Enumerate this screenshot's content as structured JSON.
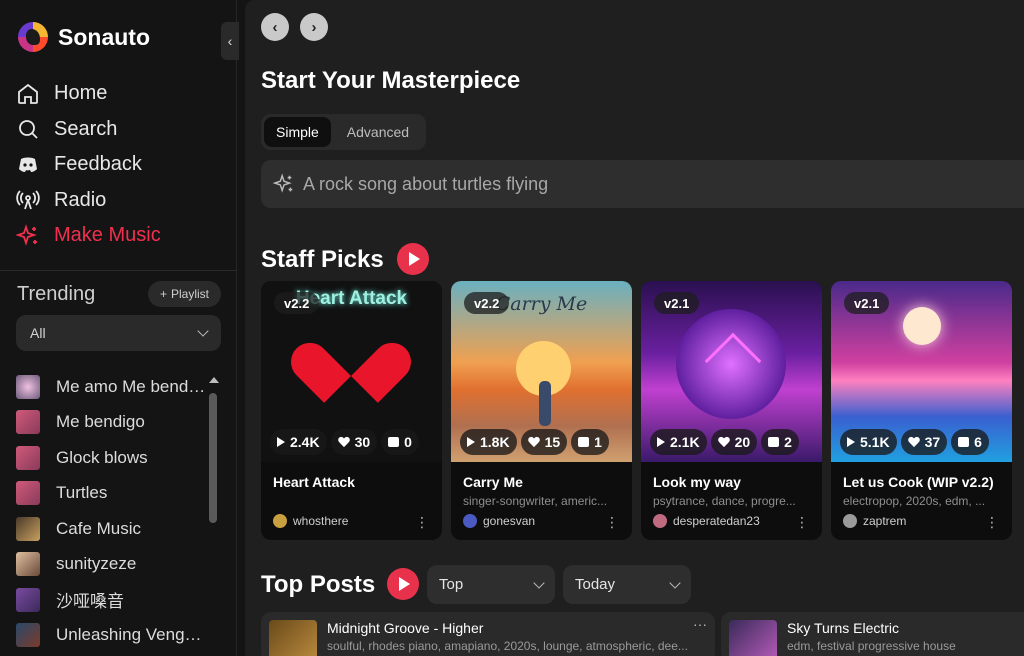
{
  "sidebar": {
    "brand": "Sonauto",
    "nav": [
      {
        "label": "Home",
        "icon": "home-icon"
      },
      {
        "label": "Search",
        "icon": "search-icon"
      },
      {
        "label": "Feedback",
        "icon": "discord-icon"
      },
      {
        "label": "Radio",
        "icon": "radio-icon"
      },
      {
        "label": "Make Music",
        "icon": "sparkle-icon",
        "active": true
      }
    ],
    "trending_title": "Trending",
    "playlist_button": "Playlist",
    "filter_value": "All",
    "trending": [
      {
        "title": "Me amo Me bendi...",
        "thumb": "#6b5a7a"
      },
      {
        "title": "Me bendigo",
        "thumb": "#b34a6a"
      },
      {
        "title": "Glock blows",
        "thumb": "#b34a6a"
      },
      {
        "title": "Turtles",
        "thumb": "#b34a6a"
      },
      {
        "title": "Cafe Music",
        "thumb": "#8a6a3a"
      },
      {
        "title": "sunityzeze",
        "thumb": "#c48a6a"
      },
      {
        "title": "沙哑嗓音",
        "thumb": "#5a3a7a"
      },
      {
        "title": "Unleashing Venge...",
        "thumb": "#3a5a7a"
      }
    ]
  },
  "main": {
    "heading": "Start Your Masterpiece",
    "modes": [
      "Simple",
      "Advanced"
    ],
    "prompt_placeholder": "A rock song about turtles flying",
    "staff_picks_title": "Staff Picks",
    "top_posts_title": "Top Posts",
    "sort_value": "Top",
    "period_value": "Today"
  },
  "cards": [
    {
      "version": "v2.2",
      "plays": "2.4K",
      "likes": "30",
      "comments": "0",
      "title": "Heart Attack",
      "subtitle": "",
      "user": "whosthere",
      "art_text": "Heart Attack"
    },
    {
      "version": "v2.2",
      "plays": "1.8K",
      "likes": "15",
      "comments": "1",
      "title": "Carry Me",
      "subtitle": "singer-songwriter, americ...",
      "user": "gonesvan",
      "art_text": "Carry Me"
    },
    {
      "version": "v2.1",
      "plays": "2.1K",
      "likes": "20",
      "comments": "2",
      "title": "Look my way",
      "subtitle": "psytrance, dance, progre...",
      "user": "desperatedan23",
      "art_text": ""
    },
    {
      "version": "v2.1",
      "plays": "5.1K",
      "likes": "37",
      "comments": "6",
      "title": "Let us Cook (WIP v2.2)",
      "subtitle": "electropop, 2020s, edm, ...",
      "user": "zaptrem",
      "art_text": ""
    }
  ],
  "posts": [
    {
      "title": "Midnight Groove - Higher",
      "subtitle": "soulful, rhodes piano, amapiano, 2020s, lounge, atmospheric, dee..."
    },
    {
      "title": "Sky Turns Electric",
      "subtitle": "edm, festival progressive house"
    }
  ]
}
